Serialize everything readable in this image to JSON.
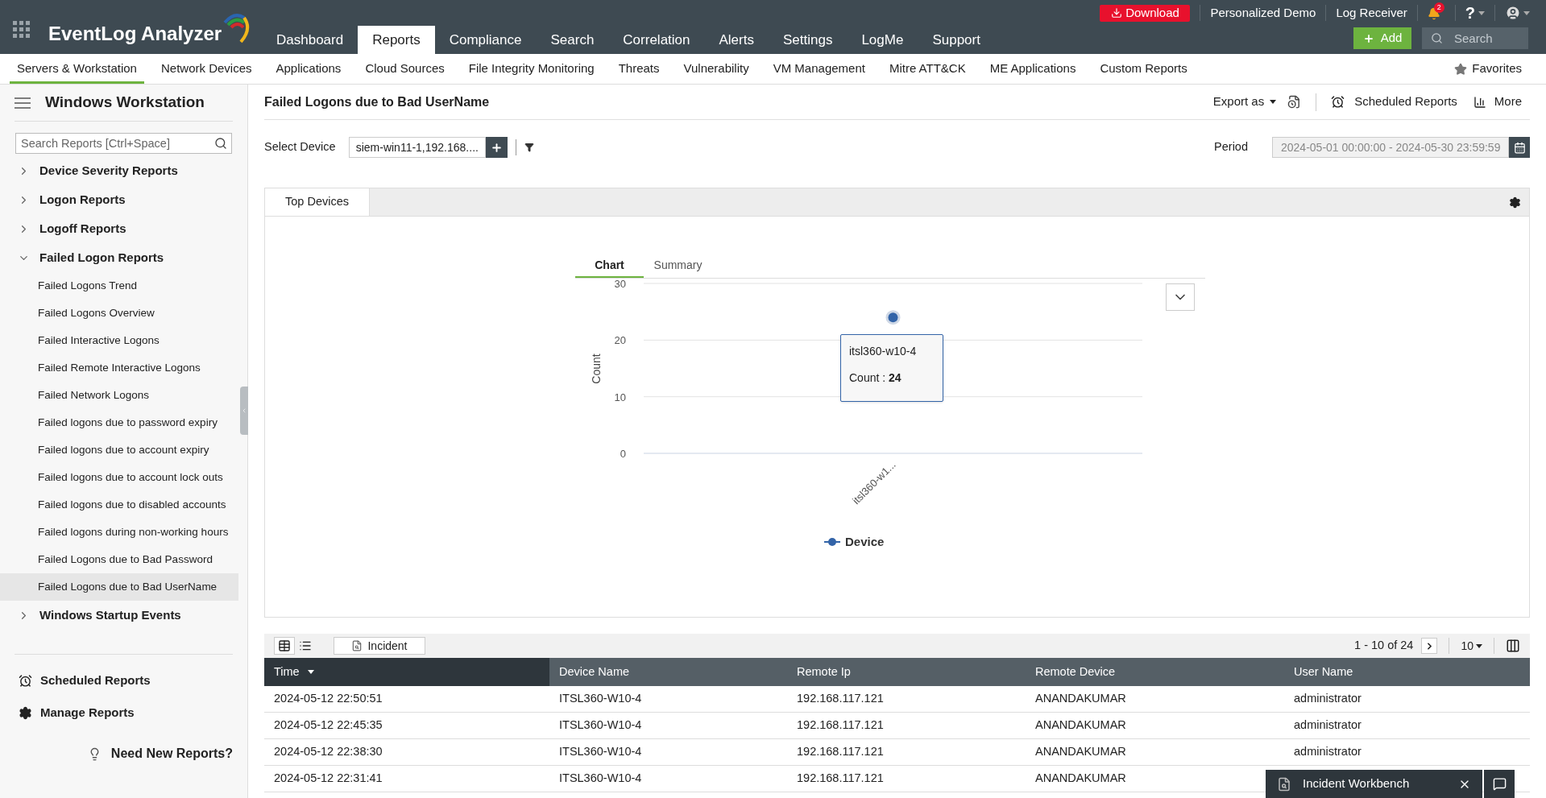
{
  "app": {
    "name": "EventLog Analyzer"
  },
  "top_bar": {
    "download": "Download",
    "links": [
      "Personalized Demo",
      "Log Receiver"
    ],
    "notification_badge": "2",
    "help": "?"
  },
  "main_tabs": [
    {
      "label": "Dashboard",
      "selected": false
    },
    {
      "label": "Reports",
      "selected": true
    },
    {
      "label": "Compliance",
      "selected": false
    },
    {
      "label": "Search",
      "selected": false
    },
    {
      "label": "Correlation",
      "selected": false
    },
    {
      "label": "Alerts",
      "selected": false
    },
    {
      "label": "Settings",
      "selected": false
    },
    {
      "label": "LogMe",
      "selected": false
    },
    {
      "label": "Support",
      "selected": false
    }
  ],
  "add_button": "Add",
  "search": {
    "placeholder": "Search"
  },
  "sub_tabs": [
    {
      "label": "Servers & Workstation",
      "selected": true
    },
    {
      "label": "Network Devices",
      "selected": false
    },
    {
      "label": "Applications",
      "selected": false
    },
    {
      "label": "Cloud Sources",
      "selected": false
    },
    {
      "label": "File Integrity Monitoring",
      "selected": false
    },
    {
      "label": "Threats",
      "selected": false
    },
    {
      "label": "Vulnerability",
      "selected": false
    },
    {
      "label": "VM Management",
      "selected": false
    },
    {
      "label": "Mitre ATT&CK",
      "selected": false
    },
    {
      "label": "ME Applications",
      "selected": false
    },
    {
      "label": "Custom Reports",
      "selected": false
    }
  ],
  "favorites": "Favorites",
  "sidebar": {
    "title": "Windows Workstation",
    "search_placeholder": "Search Reports [Ctrl+Space]",
    "tree": [
      {
        "label": "Device Severity Reports",
        "expanded": false
      },
      {
        "label": "Logon Reports",
        "expanded": false
      },
      {
        "label": "Logoff Reports",
        "expanded": false
      },
      {
        "label": "Failed Logon Reports",
        "expanded": true,
        "children": [
          {
            "label": "Failed Logons Trend",
            "selected": false
          },
          {
            "label": "Failed Logons Overview",
            "selected": false
          },
          {
            "label": "Failed Interactive Logons",
            "selected": false
          },
          {
            "label": "Failed Remote Interactive Logons",
            "selected": false
          },
          {
            "label": "Failed Network Logons",
            "selected": false
          },
          {
            "label": "Failed logons due to password expiry",
            "selected": false
          },
          {
            "label": "Failed logons due to account expiry",
            "selected": false
          },
          {
            "label": "Failed logons due to account lock outs",
            "selected": false
          },
          {
            "label": "Failed logons due to disabled accounts",
            "selected": false
          },
          {
            "label": "Failed logons during non-working hours",
            "selected": false
          },
          {
            "label": "Failed Logons due to Bad Password",
            "selected": false
          },
          {
            "label": "Failed Logons due to Bad UserName",
            "selected": true
          }
        ]
      },
      {
        "label": "Windows Startup Events",
        "expanded": false
      }
    ],
    "footer": [
      {
        "kind": "alarm",
        "label": "Scheduled Reports"
      },
      {
        "kind": "gear",
        "label": "Manage Reports"
      }
    ],
    "help": "Need New Reports?"
  },
  "report": {
    "title": "Failed Logons due to Bad UserName",
    "export": "Export as",
    "scheduled": "Scheduled Reports",
    "more": "More",
    "select_device": {
      "label": "Select Device",
      "value": "siem-win11-1,192.168...."
    },
    "period": {
      "label": "Period",
      "value": "2024-05-01 00:00:00 - 2024-05-30 23:59:59"
    },
    "panel_tabs": [
      {
        "label": "Top Devices",
        "selected": true
      }
    ],
    "chart_tabs": [
      {
        "label": "Chart",
        "selected": true
      },
      {
        "label": "Summary",
        "selected": false
      }
    ],
    "chart_data": {
      "type": "line",
      "ylabel": "Count",
      "categories": [
        "itsl360-w1..."
      ],
      "series": [
        {
          "name": "Device",
          "color": "#3364a8",
          "marker": true,
          "values": [
            24
          ]
        }
      ],
      "ylim": [
        0,
        30
      ],
      "yticks": [
        0,
        10,
        20,
        30
      ]
    },
    "tooltip": {
      "title": "itsl360-w10-4",
      "text": "Count : **24**"
    }
  },
  "table": {
    "views": [
      {
        "kind": "grid",
        "selected": true
      },
      {
        "kind": "list",
        "selected": false
      }
    ],
    "incident_button": "Incident",
    "pagination": "1 - 10 of 24",
    "page_size": "10",
    "columns": [
      {
        "label": "Time",
        "sorted": true
      },
      {
        "label": "Device Name",
        "sorted": false
      },
      {
        "label": "Remote Ip",
        "sorted": false
      },
      {
        "label": "Remote Device",
        "sorted": false
      },
      {
        "label": "User Name",
        "sorted": false
      }
    ],
    "rows": [
      [
        "2024-05-12 22:50:51",
        "ITSL360-W10-4",
        "192.168.117.121",
        "ANANDAKUMAR",
        "administrator"
      ],
      [
        "2024-05-12 22:45:35",
        "ITSL360-W10-4",
        "192.168.117.121",
        "ANANDAKUMAR",
        "administrator"
      ],
      [
        "2024-05-12 22:38:30",
        "ITSL360-W10-4",
        "192.168.117.121",
        "ANANDAKUMAR",
        "administrator"
      ],
      [
        "2024-05-12 22:31:41",
        "ITSL360-W10-4",
        "192.168.117.121",
        "ANANDAKUMAR"
      ]
    ]
  },
  "incident_workbench": {
    "label": "Incident Workbench"
  }
}
